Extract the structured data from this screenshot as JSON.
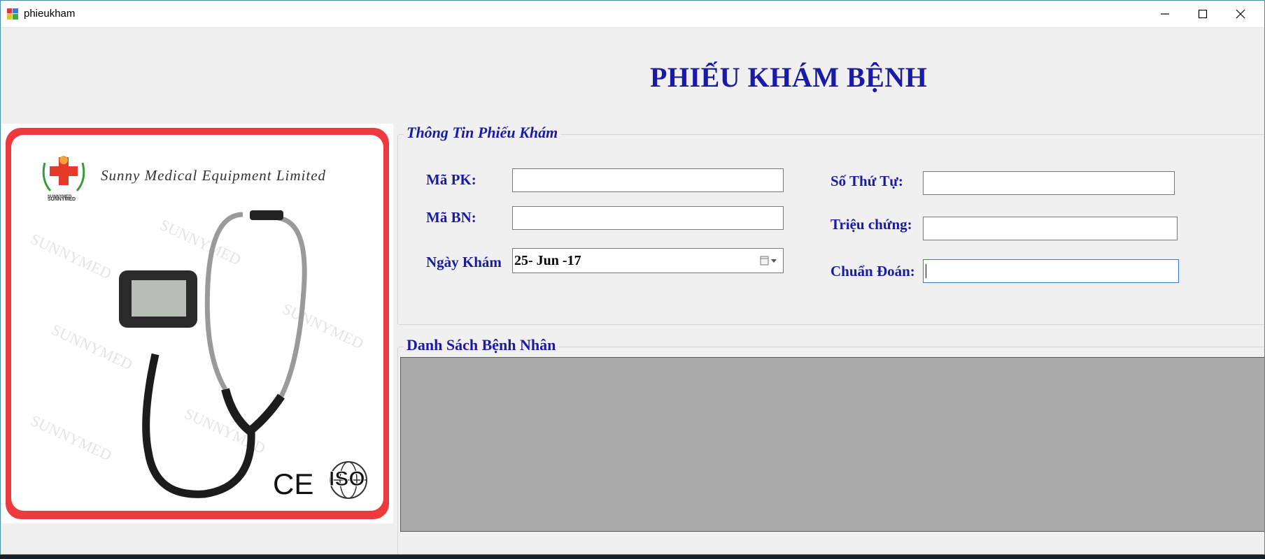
{
  "window": {
    "title": "phieukham"
  },
  "heading": "PHIẾU KHÁM BỆNH",
  "logo": {
    "company": "Sunny Medical Equipment Limited",
    "brand": "SUNNYMED",
    "cert_ce": "CE",
    "cert_iso": "ISO"
  },
  "info_group": {
    "legend": "Thông Tin Phiếu Khám",
    "ma_pk": {
      "label": "Mã PK:",
      "value": ""
    },
    "ma_bn": {
      "label": "Mã BN:",
      "value": ""
    },
    "ngay_kham": {
      "label": "Ngày Khám",
      "value": "25- Jun -17"
    },
    "so_thu_tu": {
      "label": "Số Thứ Tự:",
      "value": ""
    },
    "trieu_chung": {
      "label": "Triệu chứng:",
      "value": ""
    },
    "chuan_doan": {
      "label": "Chuẩn Đoán:",
      "value": ""
    }
  },
  "list_group": {
    "legend": "Danh Sách Bệnh Nhân"
  },
  "colors": {
    "accent": "#1a1aa8",
    "grid_bg": "#ababab",
    "logo_frame": "#ee3a3f"
  }
}
